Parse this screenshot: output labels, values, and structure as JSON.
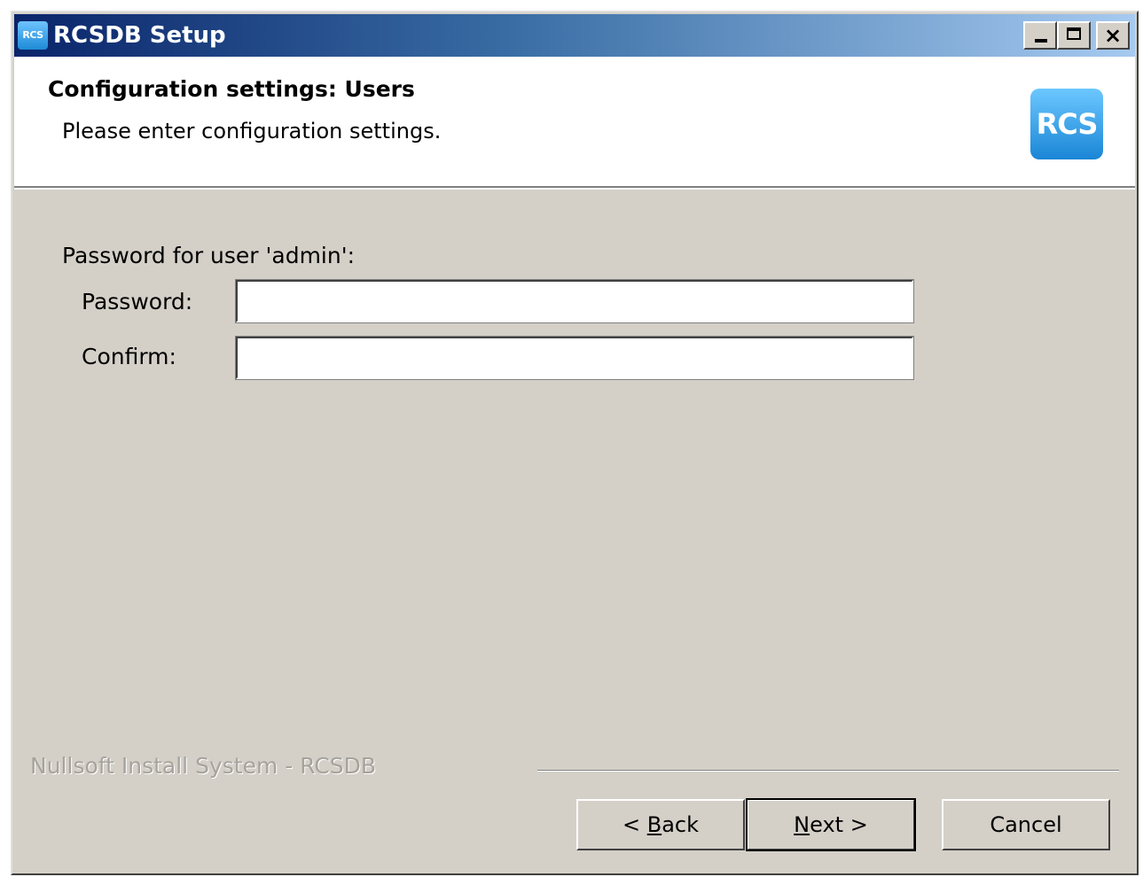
{
  "window": {
    "title": "RCSDB Setup",
    "app_icon_text": "RCS",
    "controls": {
      "minimize": "minimize-icon",
      "maximize": "maximize-icon",
      "close": "×"
    }
  },
  "header": {
    "title": "Configuration settings: Users",
    "subtitle": "Please enter configuration settings.",
    "logo_text": "RCS"
  },
  "form": {
    "section_label": "Password for user 'admin':",
    "password_label": "Password:",
    "password_value": "",
    "confirm_label": "Confirm:",
    "confirm_value": ""
  },
  "footer": {
    "branding": "Nullsoft Install System - RCSDB",
    "back": {
      "prefix": "< ",
      "accel": "B",
      "rest": "ack"
    },
    "next": {
      "accel": "N",
      "rest": "ext >"
    },
    "cancel": "Cancel"
  },
  "colors": {
    "titlebar_start": "#0a246a",
    "titlebar_end": "#a6caf0",
    "dialog_face": "#d4d0c8",
    "logo_blue": "#1a86d6"
  }
}
